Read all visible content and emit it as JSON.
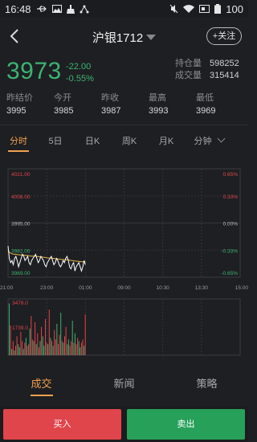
{
  "status_bar": {
    "time": "16:48",
    "battery": "100",
    "icons": [
      "usb-icon",
      "image-icon",
      "cleaner-icon",
      "share-icon",
      "mute-icon",
      "wifi-icon",
      "sim-icon",
      "battery-icon"
    ]
  },
  "nav": {
    "title": "沪银1712",
    "follow_label": "+关注",
    "back_icon": "chevron-left-icon",
    "dropdown_icon": "caret-down-icon"
  },
  "quote": {
    "price": "3973",
    "change": "-22.00",
    "change_pct": "-0.55%",
    "open_interest_label": "持仓量",
    "open_interest": "598252",
    "volume_label": "成交量",
    "volume": "315414",
    "settle_label": "昨结价",
    "settle": "3995",
    "open_label": "今开",
    "open": "3985",
    "prev_close_label": "昨收",
    "prev_close": "3987",
    "high_label": "最高",
    "high": "3993",
    "low_label": "最低",
    "low": "3969"
  },
  "tabs": [
    "分时",
    "5日",
    "日K",
    "周K",
    "月K",
    "分钟"
  ],
  "chart_data": {
    "type": "line",
    "y_left_ticks": [
      "4021.00",
      "4008.00",
      "3995.00",
      "3982.00",
      "3969.00"
    ],
    "y_right_ticks": [
      "0.65%",
      "0.33%",
      "0.00%",
      "-0.33%",
      "-0.65%"
    ],
    "x_ticks": [
      "21:00",
      "23:00",
      "01:00",
      "09:00",
      "10:30",
      "13:30",
      "15:00"
    ],
    "ylim": [
      3969,
      4021
    ],
    "price_series": [
      3984,
      3978,
      3976,
      3977,
      3975,
      3978,
      3979,
      3977,
      3974,
      3976,
      3978,
      3980,
      3979,
      3977,
      3978,
      3979,
      3976,
      3975,
      3977,
      3978,
      3979,
      3980,
      3978,
      3976,
      3977,
      3979,
      3978,
      3977,
      3975,
      3974,
      3976,
      3977,
      3978,
      3979,
      3977,
      3975,
      3976,
      3978,
      3977,
      3975,
      3974,
      3975,
      3977,
      3976,
      3978,
      3979,
      3977,
      3974,
      3973,
      3975,
      3976,
      3972,
      3974,
      3975,
      3976,
      3974,
      3972,
      3974,
      3977,
      3975
    ],
    "avg_series": [
      3982,
      3981,
      3980.5,
      3980.3,
      3980.1,
      3980,
      3980,
      3979.9,
      3979.8,
      3979.7,
      3979.7,
      3979.7,
      3979.6,
      3979.5,
      3979.5,
      3979.4,
      3979.3,
      3979.2,
      3979.1,
      3979.1,
      3979.1,
      3979.1,
      3979,
      3978.9,
      3978.8,
      3978.8,
      3978.7,
      3978.6,
      3978.5,
      3978.4,
      3978.3,
      3978.2,
      3978.2,
      3978.2,
      3978.1,
      3978,
      3977.9,
      3977.9,
      3977.8,
      3977.7,
      3977.6,
      3977.5,
      3977.5,
      3977.4,
      3977.4,
      3977.4,
      3977.3,
      3977.2,
      3977.1,
      3977,
      3976.9,
      3976.8,
      3976.7,
      3976.7,
      3976.6,
      3976.5,
      3976.4,
      3976.4,
      3976.4,
      3976.3
    ],
    "volume_ticks": [
      "3478.0",
      "1739.0"
    ],
    "volume_ylim": [
      0,
      3478
    ],
    "volume_series": [
      3300,
      1900,
      400,
      900,
      300,
      600,
      1200,
      700,
      500,
      1500,
      900,
      400,
      800,
      1100,
      600,
      700,
      1700,
      2500,
      1000,
      900,
      2100,
      700,
      1400,
      500,
      900,
      1800,
      1200,
      600,
      2300,
      800,
      700,
      2900,
      1100,
      900,
      600,
      1600,
      1000,
      2000,
      700,
      1300,
      2700,
      900,
      800,
      1200,
      1800,
      700,
      1000,
      600,
      900,
      2200,
      800,
      1400,
      700,
      1100,
      900,
      500,
      800,
      1000,
      600,
      2600
    ],
    "volume_colors_up": [
      false,
      true,
      false,
      true,
      false,
      true,
      true,
      false,
      false,
      true,
      true,
      false,
      true,
      false,
      true,
      true,
      false,
      true,
      true,
      false,
      true,
      false,
      true,
      true,
      false,
      true,
      false,
      false,
      true,
      true,
      false,
      true,
      false,
      true,
      false,
      true,
      true,
      false,
      true,
      true,
      false,
      true,
      false,
      true,
      true,
      false,
      false,
      true,
      true,
      false,
      true,
      false,
      true,
      true,
      false,
      false,
      true,
      true,
      false,
      true
    ]
  },
  "bottom_tabs": [
    "成交",
    "新闻",
    "策略"
  ],
  "actions": {
    "buy_label": "买入",
    "sell_label": "卖出"
  },
  "colors": {
    "up": "#e0454b",
    "down": "#3cb371",
    "accent": "#f0a050",
    "avg_line": "#e8b84a",
    "price_line": "#ffffff"
  }
}
